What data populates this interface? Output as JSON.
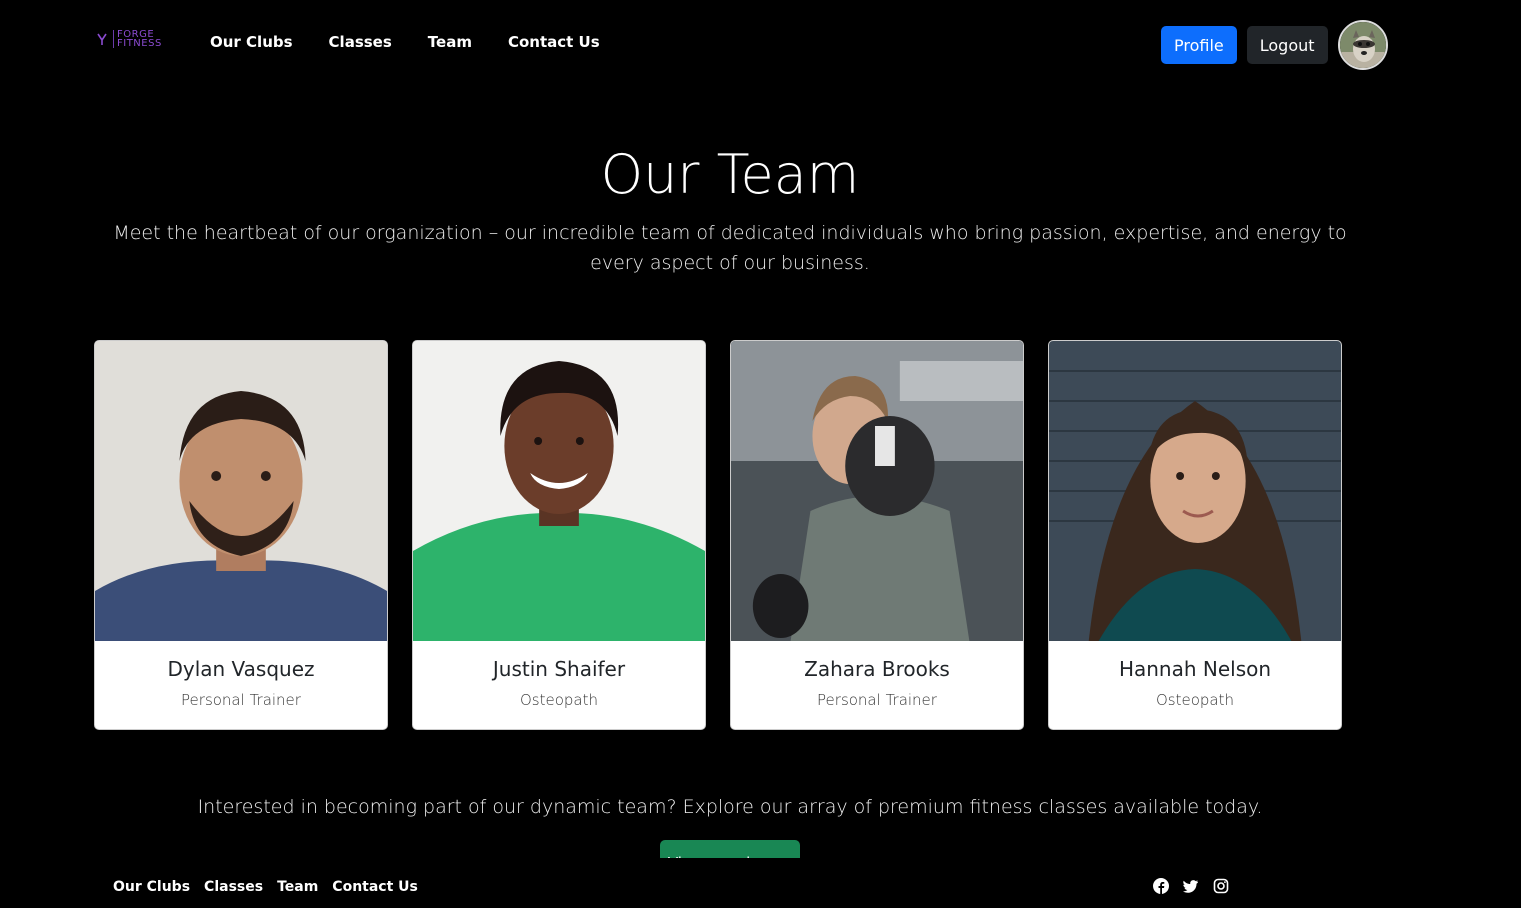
{
  "brand": {
    "line1": "FORGE",
    "line2": "FITNESS",
    "logo_icon": "dumbbell-icon",
    "accent": "#8a4bd0"
  },
  "nav": {
    "links": [
      "Our Clubs",
      "Classes",
      "Team",
      "Contact Us"
    ],
    "profile_label": "Profile",
    "logout_label": "Logout"
  },
  "hero": {
    "title": "Our Team",
    "intro": "Meet the heartbeat of our organization – our incredible team of dedicated individuals who bring passion, expertise, and energy to every aspect of our business."
  },
  "team": [
    {
      "name": "Dylan Vasquez",
      "role": "Personal Trainer"
    },
    {
      "name": "Justin Shaifer",
      "role": "Osteopath"
    },
    {
      "name": "Zahara Brooks",
      "role": "Personal Trainer"
    },
    {
      "name": "Hannah Nelson",
      "role": "Osteopath"
    }
  ],
  "cta": {
    "text": "Interested in becoming part of our dynamic team? Explore our array of premium fitness classes available today.",
    "button_label": "View our classes",
    "button_color": "#198754"
  },
  "footer": {
    "links": [
      "Our Clubs",
      "Classes",
      "Team",
      "Contact Us"
    ],
    "socials": [
      "facebook-icon",
      "twitter-icon",
      "instagram-icon"
    ]
  },
  "colors": {
    "primary": "#0d6efd",
    "dark": "#212529",
    "background": "#000000"
  }
}
